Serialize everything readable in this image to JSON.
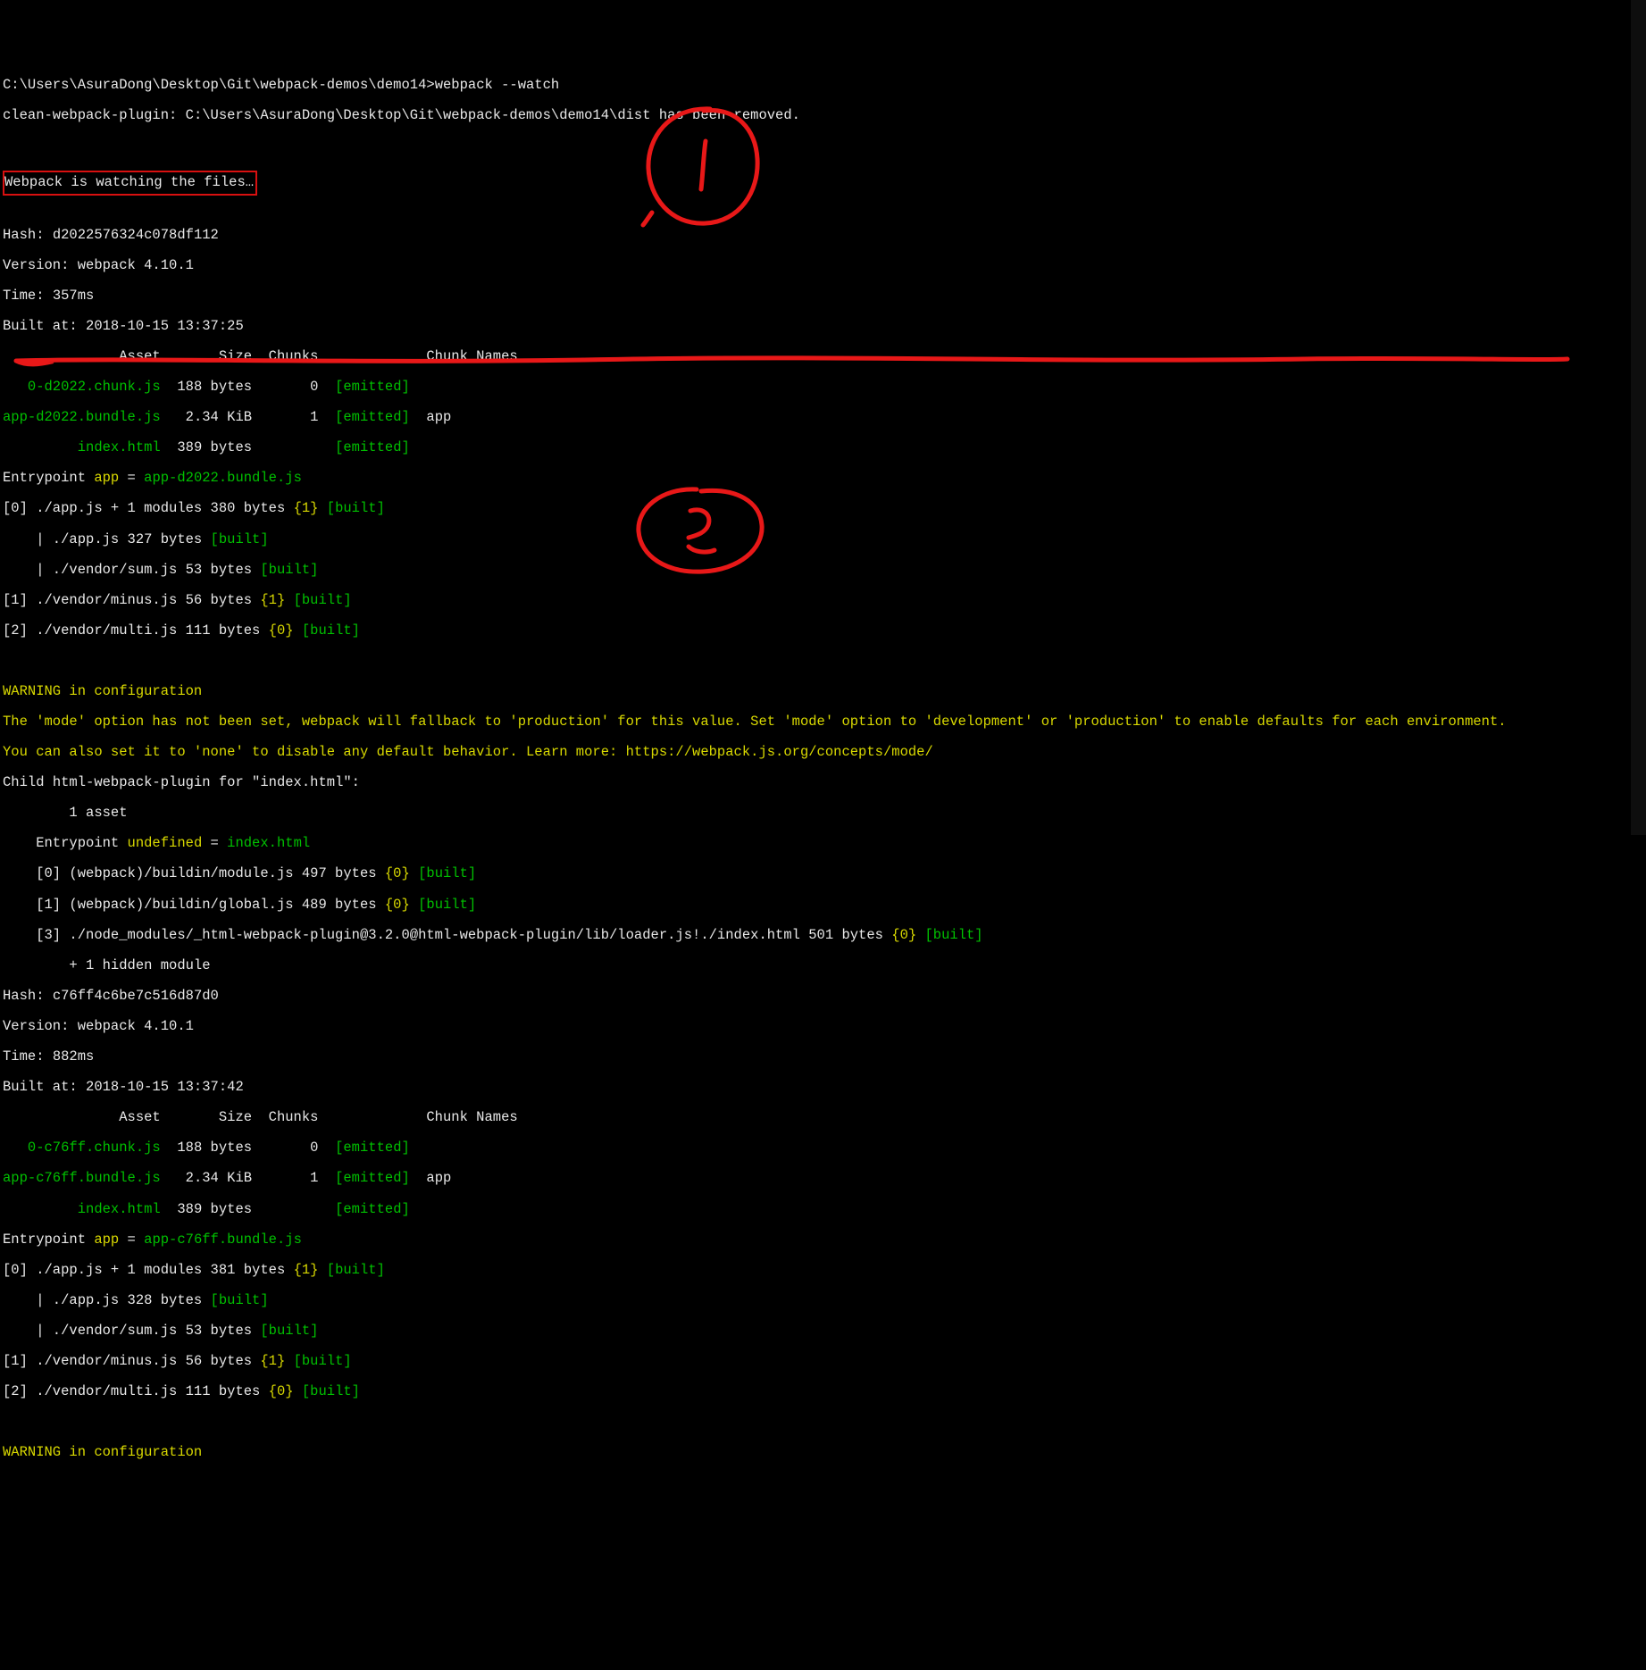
{
  "prompt": {
    "cwd": "C:\\Users\\AsuraDong\\Desktop\\Git\\webpack-demos\\demo14>",
    "cmd": "webpack --watch"
  },
  "clean": {
    "prefix": "clean-webpack-plugin: ",
    "path": "C:\\Users\\AsuraDong\\Desktop\\Git\\webpack-demos\\demo14\\dist",
    "suffix": " has been removed."
  },
  "watching": "Webpack is watching the files…",
  "build1": {
    "hash_label": "Hash: ",
    "hash": "d2022576324c078df112",
    "version_label": "Version: ",
    "version": "webpack 4.10.1",
    "time_label": "Time: ",
    "time": "357ms",
    "built_label": "Built at: ",
    "built": "2018-10-15 13:37:25",
    "header": "              Asset       Size  Chunks             Chunk Names",
    "assets": [
      {
        "name": "   0-d2022.chunk.js",
        "size": "  188 bytes",
        "chunks": "       0  ",
        "status": "[emitted]",
        "extra": "  "
      },
      {
        "name": "app-d2022.bundle.js",
        "size": "   2.34 KiB",
        "chunks": "       1  ",
        "status": "[emitted]",
        "extra": "  app"
      },
      {
        "name": "         index.html",
        "size": "  389 bytes",
        "chunks": "          ",
        "status": "[emitted]",
        "extra": "  "
      }
    ],
    "entry_label": "Entrypoint ",
    "entry_name": "app",
    "entry_eq": " = ",
    "entry_bundle": "app-d2022.bundle.js",
    "modules": [
      {
        "pre": "[0] ./app.js + 1 modules 380 bytes ",
        "b": "{1}",
        "sp": " ",
        "built": "[built]"
      },
      {
        "pre": "    | ./app.js 327 bytes ",
        "b": "",
        "sp": "",
        "built": "[built]"
      },
      {
        "pre": "    | ./vendor/sum.js 53 bytes ",
        "b": "",
        "sp": "",
        "built": "[built]"
      },
      {
        "pre": "[1] ./vendor/minus.js 56 bytes ",
        "b": "{1}",
        "sp": " ",
        "built": "[built]"
      },
      {
        "pre": "[2] ./vendor/multi.js 111 bytes ",
        "b": "{0}",
        "sp": " ",
        "built": "[built]"
      }
    ]
  },
  "warning": {
    "title": "WARNING in configuration",
    "line1": "The 'mode' option has not been set, webpack will fallback to 'production' for this value. Set 'mode' option to 'development' or 'production' to enable defaults for each environment.",
    "line2": "You can also set it to 'none' to disable any default behavior. Learn more: https://webpack.js.org/concepts/mode/"
  },
  "child": {
    "prefix": "Child ",
    "name": "html-webpack-plugin for \"index.html\"",
    "suffix": ":",
    "asset": "        1 asset",
    "entry_pre": "    Entrypoint ",
    "entry_undef": "undefined",
    "entry_eq": " = ",
    "entry_file": "index.html",
    "modules": [
      {
        "pre": "    [0] (webpack)/buildin/module.js 497 bytes ",
        "b": "{0}",
        "sp": " ",
        "built": "[built]"
      },
      {
        "pre": "    [1] (webpack)/buildin/global.js 489 bytes ",
        "b": "{0}",
        "sp": " ",
        "built": "[built]"
      },
      {
        "pre": "    [3] ./node_modules/_html-webpack-plugin@3.2.0@html-webpack-plugin/lib/loader.js!./index.html 501 bytes ",
        "b": "{0}",
        "sp": " ",
        "built": "[built]"
      }
    ],
    "hidden": "        + 1 hidden module"
  },
  "build2": {
    "hash_label": "Hash: ",
    "hash": "c76ff4c6be7c516d87d0",
    "version_label": "Version: ",
    "version": "webpack 4.10.1",
    "time_label": "Time: ",
    "time": "882ms",
    "built_label": "Built at: ",
    "built": "2018-10-15 13:37:42",
    "header": "              Asset       Size  Chunks             Chunk Names",
    "assets": [
      {
        "name": "   0-c76ff.chunk.js",
        "size": "  188 bytes",
        "chunks": "       0  ",
        "status": "[emitted]",
        "extra": "  "
      },
      {
        "name": "app-c76ff.bundle.js",
        "size": "   2.34 KiB",
        "chunks": "       1  ",
        "status": "[emitted]",
        "extra": "  app"
      },
      {
        "name": "         index.html",
        "size": "  389 bytes",
        "chunks": "          ",
        "status": "[emitted]",
        "extra": "  "
      }
    ],
    "entry_label": "Entrypoint ",
    "entry_name": "app",
    "entry_eq": " = ",
    "entry_bundle": "app-c76ff.bundle.js",
    "modules": [
      {
        "pre": "[0] ./app.js + 1 modules 381 bytes ",
        "b": "{1}",
        "sp": " ",
        "built": "[built]"
      },
      {
        "pre": "    | ./app.js 328 bytes ",
        "b": "",
        "sp": "",
        "built": "[built]"
      },
      {
        "pre": "    | ./vendor/sum.js 53 bytes ",
        "b": "",
        "sp": "",
        "built": "[built]"
      },
      {
        "pre": "[1] ./vendor/minus.js 56 bytes ",
        "b": "{1}",
        "sp": " ",
        "built": "[built]"
      },
      {
        "pre": "[2] ./vendor/multi.js 111 bytes ",
        "b": "{0}",
        "sp": " ",
        "built": "[built]"
      }
    ]
  },
  "warning2": {
    "title": "WARNING in configuration"
  }
}
